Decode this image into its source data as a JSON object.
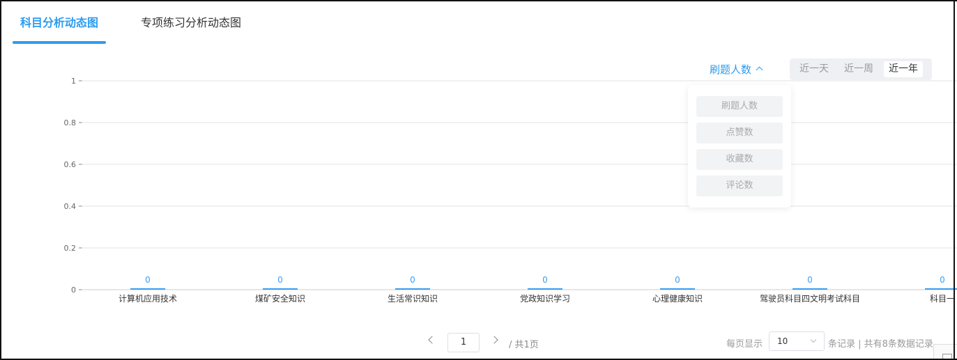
{
  "tabs": [
    {
      "label": "科目分析动态图",
      "active": true
    },
    {
      "label": "专项练习分析动态图",
      "active": false
    }
  ],
  "metric_selector": {
    "selected": "刷题人数",
    "options": [
      "刷题人数",
      "点赞数",
      "收藏数",
      "评论数"
    ]
  },
  "range_selector": {
    "options": [
      "近一天",
      "近一周",
      "近一年"
    ],
    "selected": "近一年"
  },
  "colors": {
    "accent": "#2d9cf0",
    "bar": "#3a9ff2",
    "grid": "#e3e3e3",
    "axis_text": "#666666"
  },
  "chart_data": {
    "type": "bar",
    "categories": [
      "计算机应用技术",
      "煤矿安全知识",
      "生活常识知识",
      "党政知识学习",
      "心理健康知识",
      "驾驶员科目四文明考试科目",
      "科目一"
    ],
    "values": [
      0,
      0,
      0,
      0,
      0,
      0,
      0
    ],
    "data_labels": [
      "0",
      "0",
      "0",
      "0",
      "0",
      "0",
      "0"
    ],
    "y_ticks": [
      "0",
      "0.2",
      "0.4",
      "0.6",
      "0.8",
      "1"
    ],
    "ylim": [
      0,
      1
    ],
    "grid": true,
    "title": "",
    "xlabel": "",
    "ylabel": ""
  },
  "pagination": {
    "current_page": "1",
    "total_pages_text": "/ 共1页",
    "page_size_label": "每页显示",
    "page_size": "10",
    "records_text": "条记录 | 共有8条数据记录"
  }
}
